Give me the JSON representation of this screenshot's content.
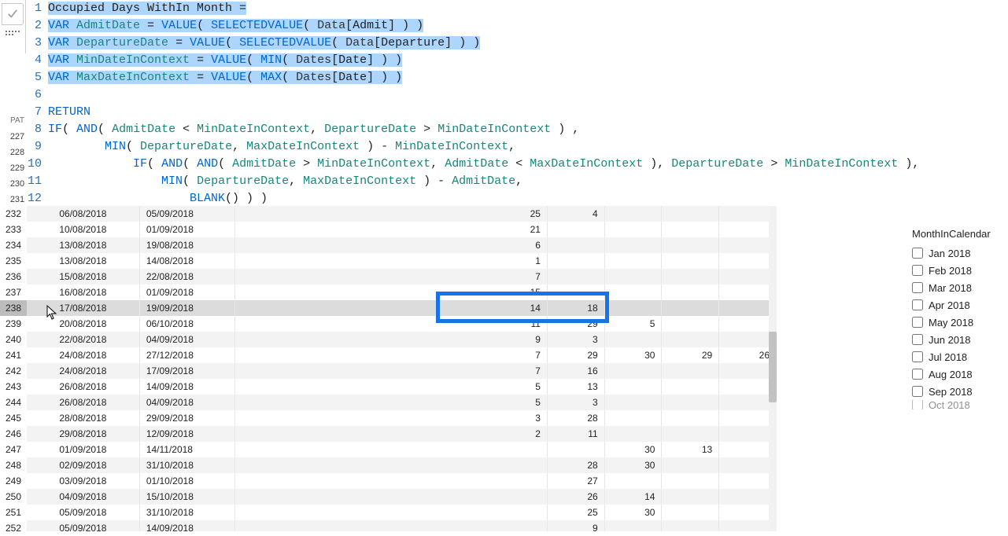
{
  "editor": {
    "measure_name": "Occupied Days WithIn Month =",
    "lines": [
      {
        "ln": 1,
        "raw": "Occupied Days WithIn Month =",
        "sel": true
      },
      {
        "ln": 2,
        "raw": "VAR AdmitDate = VALUE( SELECTEDVALUE( Data[Admit] ) )",
        "sel": true
      },
      {
        "ln": 3,
        "raw": "VAR DepartureDate = VALUE( SELECTEDVALUE( Data[Departure] ) )",
        "sel": true
      },
      {
        "ln": 4,
        "raw": "VAR MinDateInContext = VALUE( MIN( Dates[Date] ) )",
        "sel": true
      },
      {
        "ln": 5,
        "raw": "VAR MaxDateInContext = VALUE( MAX( Dates[Date] ) )",
        "sel": true
      },
      {
        "ln": 6,
        "raw": "",
        "sel": false
      },
      {
        "ln": 7,
        "raw": "RETURN",
        "sel": false
      },
      {
        "ln": 8,
        "raw": "IF( AND( AdmitDate < MinDateInContext, DepartureDate > MinDateInContext ) ,",
        "sel": false
      },
      {
        "ln": 9,
        "raw": "        MIN( DepartureDate, MaxDateInContext ) - MinDateInContext,",
        "sel": false
      },
      {
        "ln": 10,
        "raw": "            IF( AND( AND( AdmitDate > MinDateInContext, AdmitDate < MaxDateInContext ), DepartureDate > MinDateInContext ),",
        "sel": false
      },
      {
        "ln": 11,
        "raw": "                MIN( DepartureDate, MaxDateInContext ) - AdmitDate,",
        "sel": false
      },
      {
        "ln": 12,
        "raw": "                    BLANK() ) )",
        "sel": false
      }
    ]
  },
  "idx_peek": {
    "label": "PAT",
    "nums": [
      "227",
      "228",
      "229",
      "230",
      "231"
    ]
  },
  "table": {
    "selected_row_index": 238,
    "rows": [
      {
        "idx": 232,
        "d1": "06/08/2018",
        "d2": "05/09/2018",
        "v1": "25",
        "v2": "4",
        "v3": "",
        "v4": "",
        "v5": ""
      },
      {
        "idx": 233,
        "d1": "10/08/2018",
        "d2": "01/09/2018",
        "v1": "21",
        "v2": "",
        "v3": "",
        "v4": "",
        "v5": ""
      },
      {
        "idx": 234,
        "d1": "13/08/2018",
        "d2": "19/08/2018",
        "v1": "6",
        "v2": "",
        "v3": "",
        "v4": "",
        "v5": ""
      },
      {
        "idx": 235,
        "d1": "13/08/2018",
        "d2": "14/08/2018",
        "v1": "1",
        "v2": "",
        "v3": "",
        "v4": "",
        "v5": ""
      },
      {
        "idx": 236,
        "d1": "15/08/2018",
        "d2": "22/08/2018",
        "v1": "7",
        "v2": "",
        "v3": "",
        "v4": "",
        "v5": ""
      },
      {
        "idx": 237,
        "d1": "16/08/2018",
        "d2": "01/09/2018",
        "v1": "15",
        "v2": "",
        "v3": "",
        "v4": "",
        "v5": ""
      },
      {
        "idx": 238,
        "d1": "17/08/2018",
        "d2": "19/09/2018",
        "v1": "14",
        "v2": "18",
        "v3": "",
        "v4": "",
        "v5": ""
      },
      {
        "idx": 239,
        "d1": "20/08/2018",
        "d2": "06/10/2018",
        "v1": "11",
        "v2": "29",
        "v3": "5",
        "v4": "",
        "v5": ""
      },
      {
        "idx": 240,
        "d1": "22/08/2018",
        "d2": "04/09/2018",
        "v1": "9",
        "v2": "3",
        "v3": "",
        "v4": "",
        "v5": ""
      },
      {
        "idx": 241,
        "d1": "24/08/2018",
        "d2": "27/12/2018",
        "v1": "7",
        "v2": "29",
        "v3": "30",
        "v4": "29",
        "v5": "26"
      },
      {
        "idx": 242,
        "d1": "24/08/2018",
        "d2": "17/09/2018",
        "v1": "7",
        "v2": "16",
        "v3": "",
        "v4": "",
        "v5": ""
      },
      {
        "idx": 243,
        "d1": "26/08/2018",
        "d2": "14/09/2018",
        "v1": "5",
        "v2": "13",
        "v3": "",
        "v4": "",
        "v5": ""
      },
      {
        "idx": 244,
        "d1": "26/08/2018",
        "d2": "04/09/2018",
        "v1": "5",
        "v2": "3",
        "v3": "",
        "v4": "",
        "v5": ""
      },
      {
        "idx": 245,
        "d1": "28/08/2018",
        "d2": "29/09/2018",
        "v1": "3",
        "v2": "28",
        "v3": "",
        "v4": "",
        "v5": ""
      },
      {
        "idx": 246,
        "d1": "29/08/2018",
        "d2": "12/09/2018",
        "v1": "2",
        "v2": "11",
        "v3": "",
        "v4": "",
        "v5": ""
      },
      {
        "idx": 247,
        "d1": "01/09/2018",
        "d2": "14/11/2018",
        "v1": "",
        "v2": "",
        "v3": "30",
        "v4": "13",
        "v5": ""
      },
      {
        "idx": 248,
        "d1": "02/09/2018",
        "d2": "31/10/2018",
        "v1": "",
        "v2": "28",
        "v3": "30",
        "v4": "",
        "v5": ""
      },
      {
        "idx": 249,
        "d1": "03/09/2018",
        "d2": "01/10/2018",
        "v1": "",
        "v2": "27",
        "v3": "",
        "v4": "",
        "v5": ""
      },
      {
        "idx": 250,
        "d1": "04/09/2018",
        "d2": "15/10/2018",
        "v1": "",
        "v2": "26",
        "v3": "14",
        "v4": "",
        "v5": ""
      },
      {
        "idx": 251,
        "d1": "05/09/2018",
        "d2": "31/10/2018",
        "v1": "",
        "v2": "25",
        "v3": "30",
        "v4": "",
        "v5": ""
      },
      {
        "idx": 252,
        "d1": "05/09/2018",
        "d2": "14/09/2018",
        "v1": "",
        "v2": "9",
        "v3": "",
        "v4": "",
        "v5": ""
      }
    ]
  },
  "slicer": {
    "title": "MonthInCalendar",
    "items": [
      "Jan 2018",
      "Feb 2018",
      "Mar 2018",
      "Apr 2018",
      "May 2018",
      "Jun 2018",
      "Jul 2018",
      "Aug 2018",
      "Sep 2018",
      "Oct 2018"
    ]
  }
}
